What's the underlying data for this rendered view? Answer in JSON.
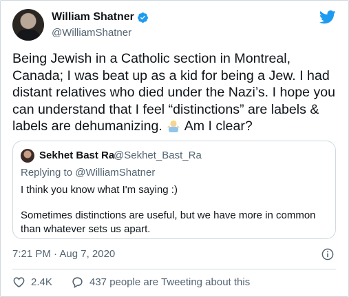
{
  "author": {
    "display_name": "William Shatner",
    "handle": "@WilliamShatner",
    "verified": true
  },
  "tweet": {
    "text_before_emoji": "Being Jewish in a Catholic section in Montreal, Canada; I was beat up as a kid for being a Jew. I had distant relatives who died under the Nazi’s. I hope you can understand that I feel “distinctions” are labels & labels are dehumanizing.",
    "emoji": "man-shrugging-emoji",
    "text_after_emoji": "Am I clear?"
  },
  "quoted_tweet": {
    "display_name": "Sekhet Bast Ra",
    "handle": "@Sekhet_Bast_Ra",
    "replying_to_label": "Replying to",
    "replying_to_handle": "@WilliamShatner",
    "line1": "I think you know what I'm saying :)",
    "paragraph2": "Sometimes distinctions are useful, but we have more in common than whatever sets us apart."
  },
  "timestamp": "7:21 PM · Aug 7, 2020",
  "actions": {
    "like_count": "2.4K",
    "conversation_text": "437 people are Tweeting about this"
  },
  "colors": {
    "brand_blue": "#1d9bf0",
    "text_primary": "#0f1419",
    "text_secondary": "#536471",
    "border": "#cfd9de"
  },
  "icons": [
    "twitter-bird-icon",
    "verified-badge-icon",
    "info-icon",
    "heart-icon",
    "speech-bubble-icon"
  ]
}
